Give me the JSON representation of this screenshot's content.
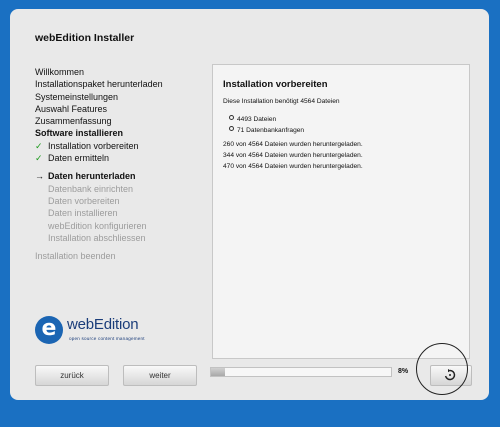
{
  "app_title": "webEdition Installer",
  "steps": [
    {
      "label": "Willkommen",
      "state": "done"
    },
    {
      "label": "Installationspaket herunterladen",
      "state": "done"
    },
    {
      "label": "Systemeinstellungen",
      "state": "done"
    },
    {
      "label": "Auswahl Features",
      "state": "done"
    },
    {
      "label": "Zusammenfassung",
      "state": "done"
    },
    {
      "label": "Software installieren",
      "state": "current-section"
    },
    {
      "label": "Installation vorbereiten",
      "state": "done-check"
    },
    {
      "label": "Daten ermitteln",
      "state": "done-check"
    },
    {
      "label": "Daten herunterladen",
      "state": "active"
    },
    {
      "label": "Datenbank einrichten",
      "state": "pending"
    },
    {
      "label": "Daten vorbereiten",
      "state": "pending"
    },
    {
      "label": "Daten installieren",
      "state": "pending"
    },
    {
      "label": "webEdition konfigurieren",
      "state": "pending"
    },
    {
      "label": "Installation abschliessen",
      "state": "pending"
    },
    {
      "label": "Installation beenden",
      "state": "pending"
    }
  ],
  "panel": {
    "title": "Installation vorbereiten",
    "intro": "Diese Installation benötigt 4564 Dateien",
    "bullets": [
      "4493 Dateien",
      "71 Datenbankanfragen"
    ],
    "log": [
      "260 von 4564 Dateien wurden heruntergeladen.",
      "344 von 4564 Dateien wurden heruntergeladen.",
      "470 von 4564 Dateien wurden heruntergeladen."
    ]
  },
  "logo": {
    "letter": "e",
    "name": "webEdition",
    "tagline": "open source content management"
  },
  "buttons": {
    "back": "zurück",
    "next": "weiter"
  },
  "progress": {
    "value": 0.08,
    "label": "8%"
  },
  "icons": {
    "reload": "reload-icon"
  },
  "colors": {
    "background": "#1a70c2",
    "check": "#1d9a1d",
    "logo": "#1b65b3"
  }
}
